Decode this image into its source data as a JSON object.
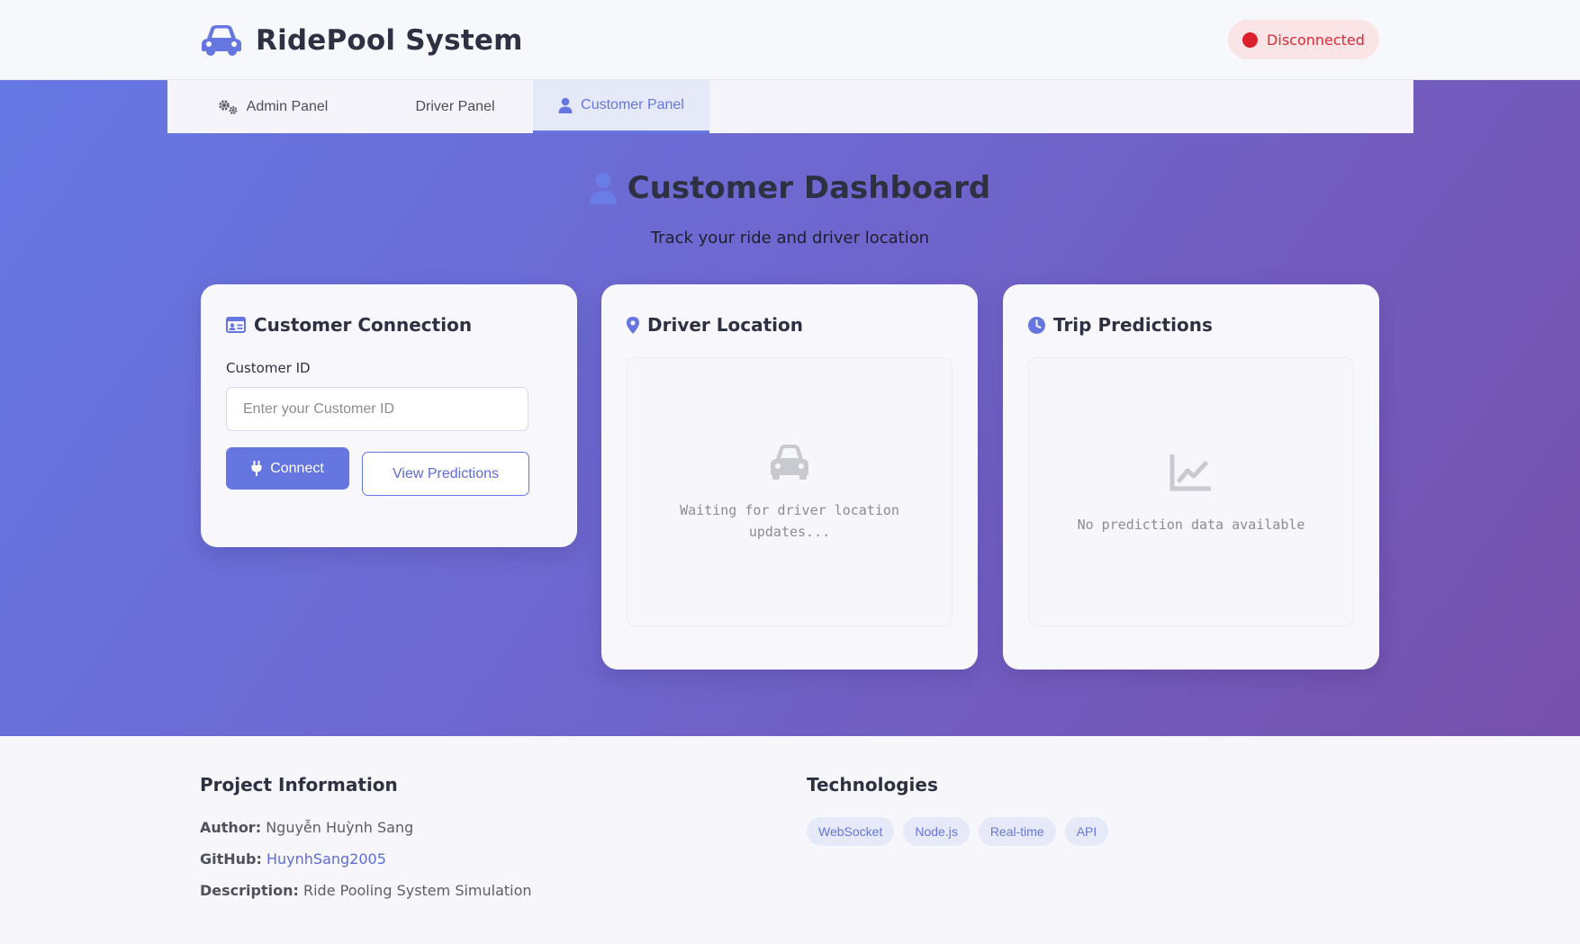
{
  "app": {
    "title": "RidePool System",
    "logo_icon": "car-icon",
    "status": "Disconnected",
    "status_color": "#dc1f2d"
  },
  "tabs": [
    {
      "label": "Admin Panel",
      "icon": "gears-icon"
    },
    {
      "label": "Driver Panel",
      "icon": ""
    },
    {
      "label": "Customer Panel",
      "icon": "user-icon",
      "active": true
    }
  ],
  "dashboard": {
    "title": "Customer Dashboard",
    "subtitle": "Track your ride and driver location"
  },
  "connection_card": {
    "title": "Customer Connection",
    "field_label": "Customer ID",
    "input_value": "",
    "input_placeholder": "Enter your Customer ID",
    "connect_label": "Connect",
    "view_predictions_label": "View Predictions"
  },
  "driver_location_card": {
    "title": "Driver Location",
    "empty_text": "Waiting for driver location updates..."
  },
  "predictions_card": {
    "title": "Trip Predictions",
    "empty_text": "No prediction data available"
  },
  "footer": {
    "project_title": "Project Information",
    "author_label": "Author:",
    "author_value": "Nguyễn Huỳnh Sang",
    "github_label": "GitHub:",
    "github_value": "HuynhSang2005",
    "description_label": "Description:",
    "description_value": "Ride Pooling System Simulation",
    "tech_title": "Technologies",
    "tags": [
      "WebSocket",
      "Node.js",
      "Real-time",
      "API"
    ]
  },
  "colors": {
    "accent": "#6676e0",
    "gradient_start": "#6678e4",
    "gradient_end": "#7650ab"
  }
}
